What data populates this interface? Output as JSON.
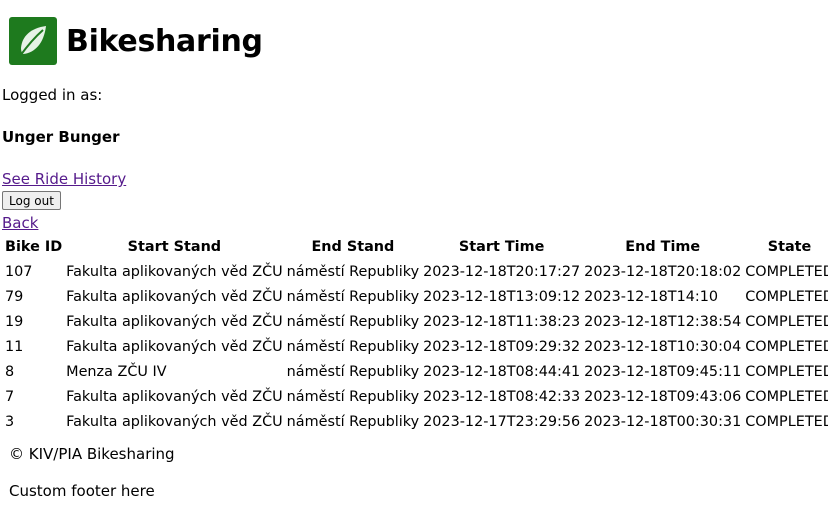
{
  "header": {
    "brand": "Bikesharing",
    "logo_icon": "leaf-icon",
    "logo_color": "#1e7a1e"
  },
  "session": {
    "logged_in_label": "Logged in as:",
    "user_name": "Unger Bunger"
  },
  "nav": {
    "history_link": "See Ride History",
    "logout_button": "Log out",
    "back_link": "Back"
  },
  "table": {
    "headers": [
      "Bike ID",
      "Start Stand",
      "End Stand",
      "Start Time",
      "End Time",
      "State"
    ],
    "rows": [
      [
        "107",
        "Fakulta aplikovaných věd ZČU",
        "náměstí Republiky",
        "2023-12-18T20:17:27",
        "2023-12-18T20:18:02",
        "COMPLETED"
      ],
      [
        "79",
        "Fakulta aplikovaných věd ZČU",
        "náměstí Republiky",
        "2023-12-18T13:09:12",
        "2023-12-18T14:10",
        "COMPLETED"
      ],
      [
        "19",
        "Fakulta aplikovaných věd ZČU",
        "náměstí Republiky",
        "2023-12-18T11:38:23",
        "2023-12-18T12:38:54",
        "COMPLETED"
      ],
      [
        "11",
        "Fakulta aplikovaných věd ZČU",
        "náměstí Republiky",
        "2023-12-18T09:29:32",
        "2023-12-18T10:30:04",
        "COMPLETED"
      ],
      [
        "8",
        "Menza ZČU IV",
        "náměstí Republiky",
        "2023-12-18T08:44:41",
        "2023-12-18T09:45:11",
        "COMPLETED"
      ],
      [
        "7",
        "Fakulta aplikovaných věd ZČU",
        "náměstí Republiky",
        "2023-12-18T08:42:33",
        "2023-12-18T09:43:06",
        "COMPLETED"
      ],
      [
        "3",
        "Fakulta aplikovaných věd ZČU",
        "náměstí Republiky",
        "2023-12-17T23:29:56",
        "2023-12-18T00:30:31",
        "COMPLETED"
      ]
    ]
  },
  "footer": {
    "copyright": "© KIV/PIA Bikesharing",
    "custom": "Custom footer here"
  }
}
